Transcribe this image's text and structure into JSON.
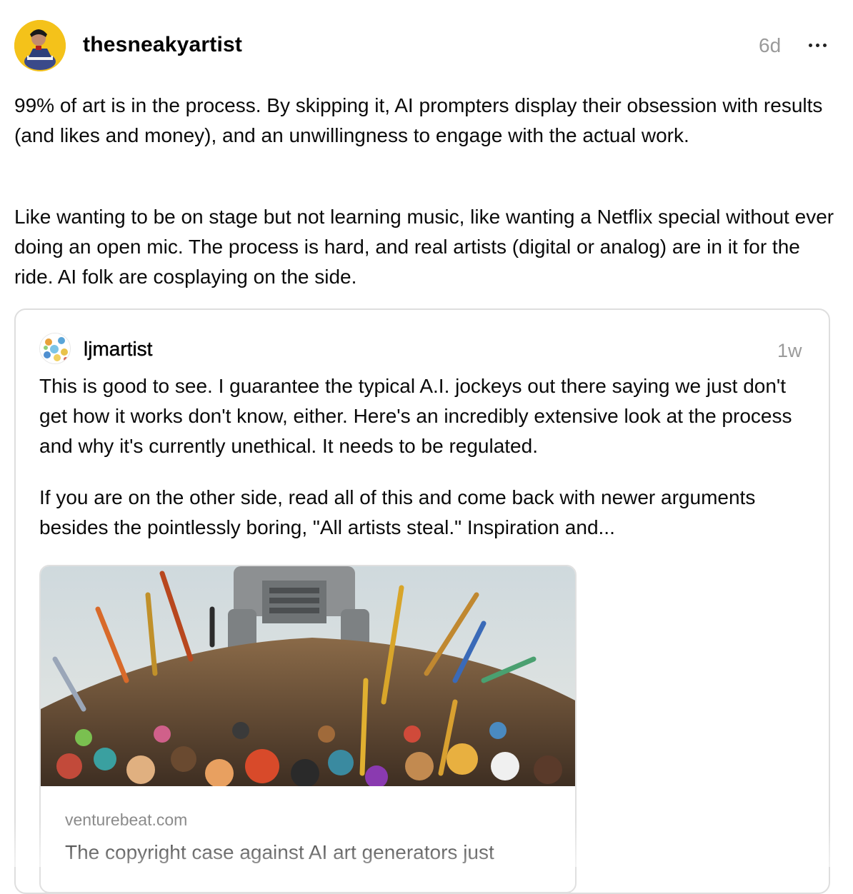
{
  "post": {
    "username": "thesneakyartist",
    "time": "6d",
    "more_icon": "more-horizontal-icon",
    "paragraphs": [
      "99% of art is in the process. By skipping it, AI prompters display their obsession with results (and likes and money), and an unwillingness to engage with the actual work.",
      "Like wanting to be on stage but not learning music, like wanting a Netflix special without ever doing an open mic. The process is hard, and real artists (digital or analog) are in it for the ride. AI folk are cosplaying on the side."
    ]
  },
  "quoted": {
    "username": "ljmartist",
    "time": "1w",
    "paragraphs": [
      "This is good to see. I guarantee the typical A.I. jockeys out there saying we just don't get how it works don't know, either. Here's an incredibly extensive look at the process and why it's currently unethical. It needs to be regulated.",
      "If you are on the other side, read all of this and come back with newer arguments besides the pointlessly boring, \"All artists steal.\" Inspiration and..."
    ],
    "link": {
      "domain": "venturebeat.com",
      "title": "The copyright case against AI art generators just"
    }
  },
  "colors": {
    "avatar_bg": "#f4c21a",
    "meta_gray": "#9a9a9a",
    "card_border": "#dedede"
  }
}
